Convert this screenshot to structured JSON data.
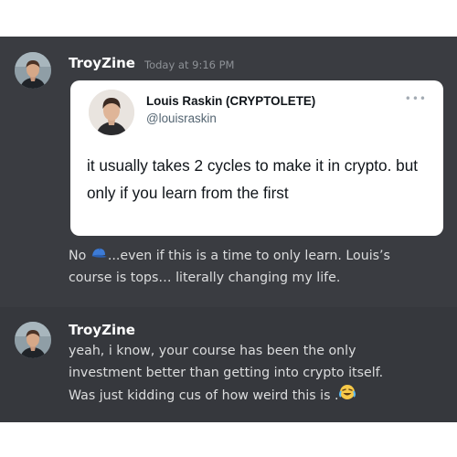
{
  "message1": {
    "username": "TroyZine",
    "timestamp": "Today at 9:16 PM",
    "embed": {
      "author_name": "Louis Raskin (CRYPTOLETE)",
      "author_handle": "@louisraskin",
      "more_icon": "more-dots-icon",
      "body": "it usually takes 2 cycles to make it in crypto. but only if you learn from the first"
    },
    "reply_prefix": "No",
    "reply_emoji": "blue-cap-emoji",
    "reply_line1": "...even if this is a time to only learn. Louis’s",
    "reply_line2": "course is tops… literally changing my life."
  },
  "message2": {
    "username": "TroyZine",
    "line1": "yeah, i know, your course has been the only",
    "line2": "investment better than getting into crypto itself.",
    "line3": "Was just kidding cus of how weird this is .",
    "emoji": "laughing-tears-emoji"
  },
  "colors": {
    "chat_bg": "#3a3c41",
    "username": "#ffffff",
    "message_text": "#dcddde",
    "timestamp": "#8e9297",
    "embed_bg": "#ffffff"
  }
}
